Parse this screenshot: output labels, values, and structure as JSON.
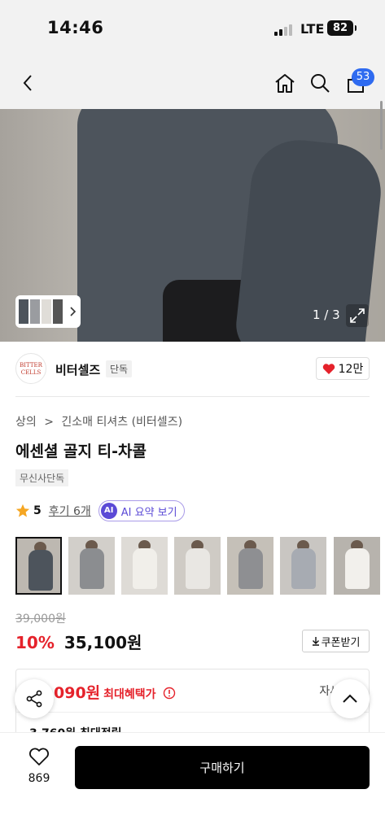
{
  "status_bar": {
    "time": "14:46",
    "network": "LTE",
    "battery": "82"
  },
  "nav": {
    "cart_count": "53"
  },
  "hero": {
    "counter": "1 / 3"
  },
  "brand": {
    "logo_text": "BITTER CELLS",
    "name": "비터셀즈",
    "tag": "단독",
    "likes": "12만"
  },
  "breadcrumb": {
    "level1": "상의",
    "separator": ">",
    "level2": "긴소매 티셔츠 (비터셀즈)"
  },
  "product": {
    "title": "에센셜 골지 티-차콜",
    "exclusive_tag": "무신사단독"
  },
  "rating": {
    "score": "5",
    "review_link": "후기 6개",
    "ai_badge": "AI",
    "ai_summary": "AI 요약 보기"
  },
  "gallery": {
    "thumbs": [
      {
        "color": "#4d545c"
      },
      {
        "color": "#8b8d90"
      },
      {
        "color": "#f1efea"
      },
      {
        "color": "#e9e7e3"
      },
      {
        "color": "#8e8f92"
      },
      {
        "color": "#a7abb2"
      },
      {
        "color": "#f2f0ec"
      },
      {
        "color": "#dcdfd0"
      }
    ]
  },
  "price": {
    "original": "39,000원",
    "discount": "10%",
    "current": "35,100원",
    "coupon_label": "쿠폰받기"
  },
  "benefit": {
    "max_amount": "090원",
    "max_label": "최대혜택가",
    "detail_label": "자세히",
    "points": "3,760원 최대적립"
  },
  "bottom": {
    "likes": "869",
    "buy_label": "구매하기"
  },
  "colors": {
    "accent_red": "#e5222b",
    "badge_blue": "#2f6bf0",
    "ai_purple": "#5b4ad6"
  }
}
